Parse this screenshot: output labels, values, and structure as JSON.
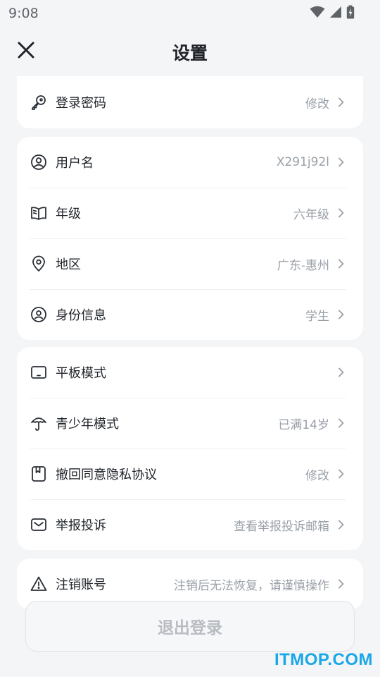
{
  "status_bar": {
    "time": "9:08"
  },
  "header": {
    "title": "设置"
  },
  "card_account": {
    "rows": [
      {
        "label": "登录密码",
        "value": "修改"
      }
    ]
  },
  "card_profile": {
    "rows": [
      {
        "label": "用户名",
        "value": "X291j92l"
      },
      {
        "label": "年级",
        "value": "六年级"
      },
      {
        "label": "地区",
        "value": "广东-惠州"
      },
      {
        "label": "身份信息",
        "value": "学生"
      }
    ]
  },
  "card_modes": {
    "rows": [
      {
        "label": "平板模式",
        "value": ""
      },
      {
        "label": "青少年模式",
        "value": "已满14岁"
      },
      {
        "label": "撤回同意隐私协议",
        "value": "修改"
      },
      {
        "label": "举报投诉",
        "value": "查看举报投诉邮箱"
      }
    ]
  },
  "card_danger": {
    "rows": [
      {
        "label": "注销账号",
        "value": "注销后无法恢复，请谨慎操作"
      }
    ]
  },
  "logout": {
    "label": "退出登录"
  },
  "watermark": "ITMOP.COM",
  "colors": {
    "background": "#f4f5f7",
    "card": "#ffffff",
    "text": "#1f2329",
    "muted": "#9aa0a8",
    "watermark": "#1aa7e8"
  }
}
